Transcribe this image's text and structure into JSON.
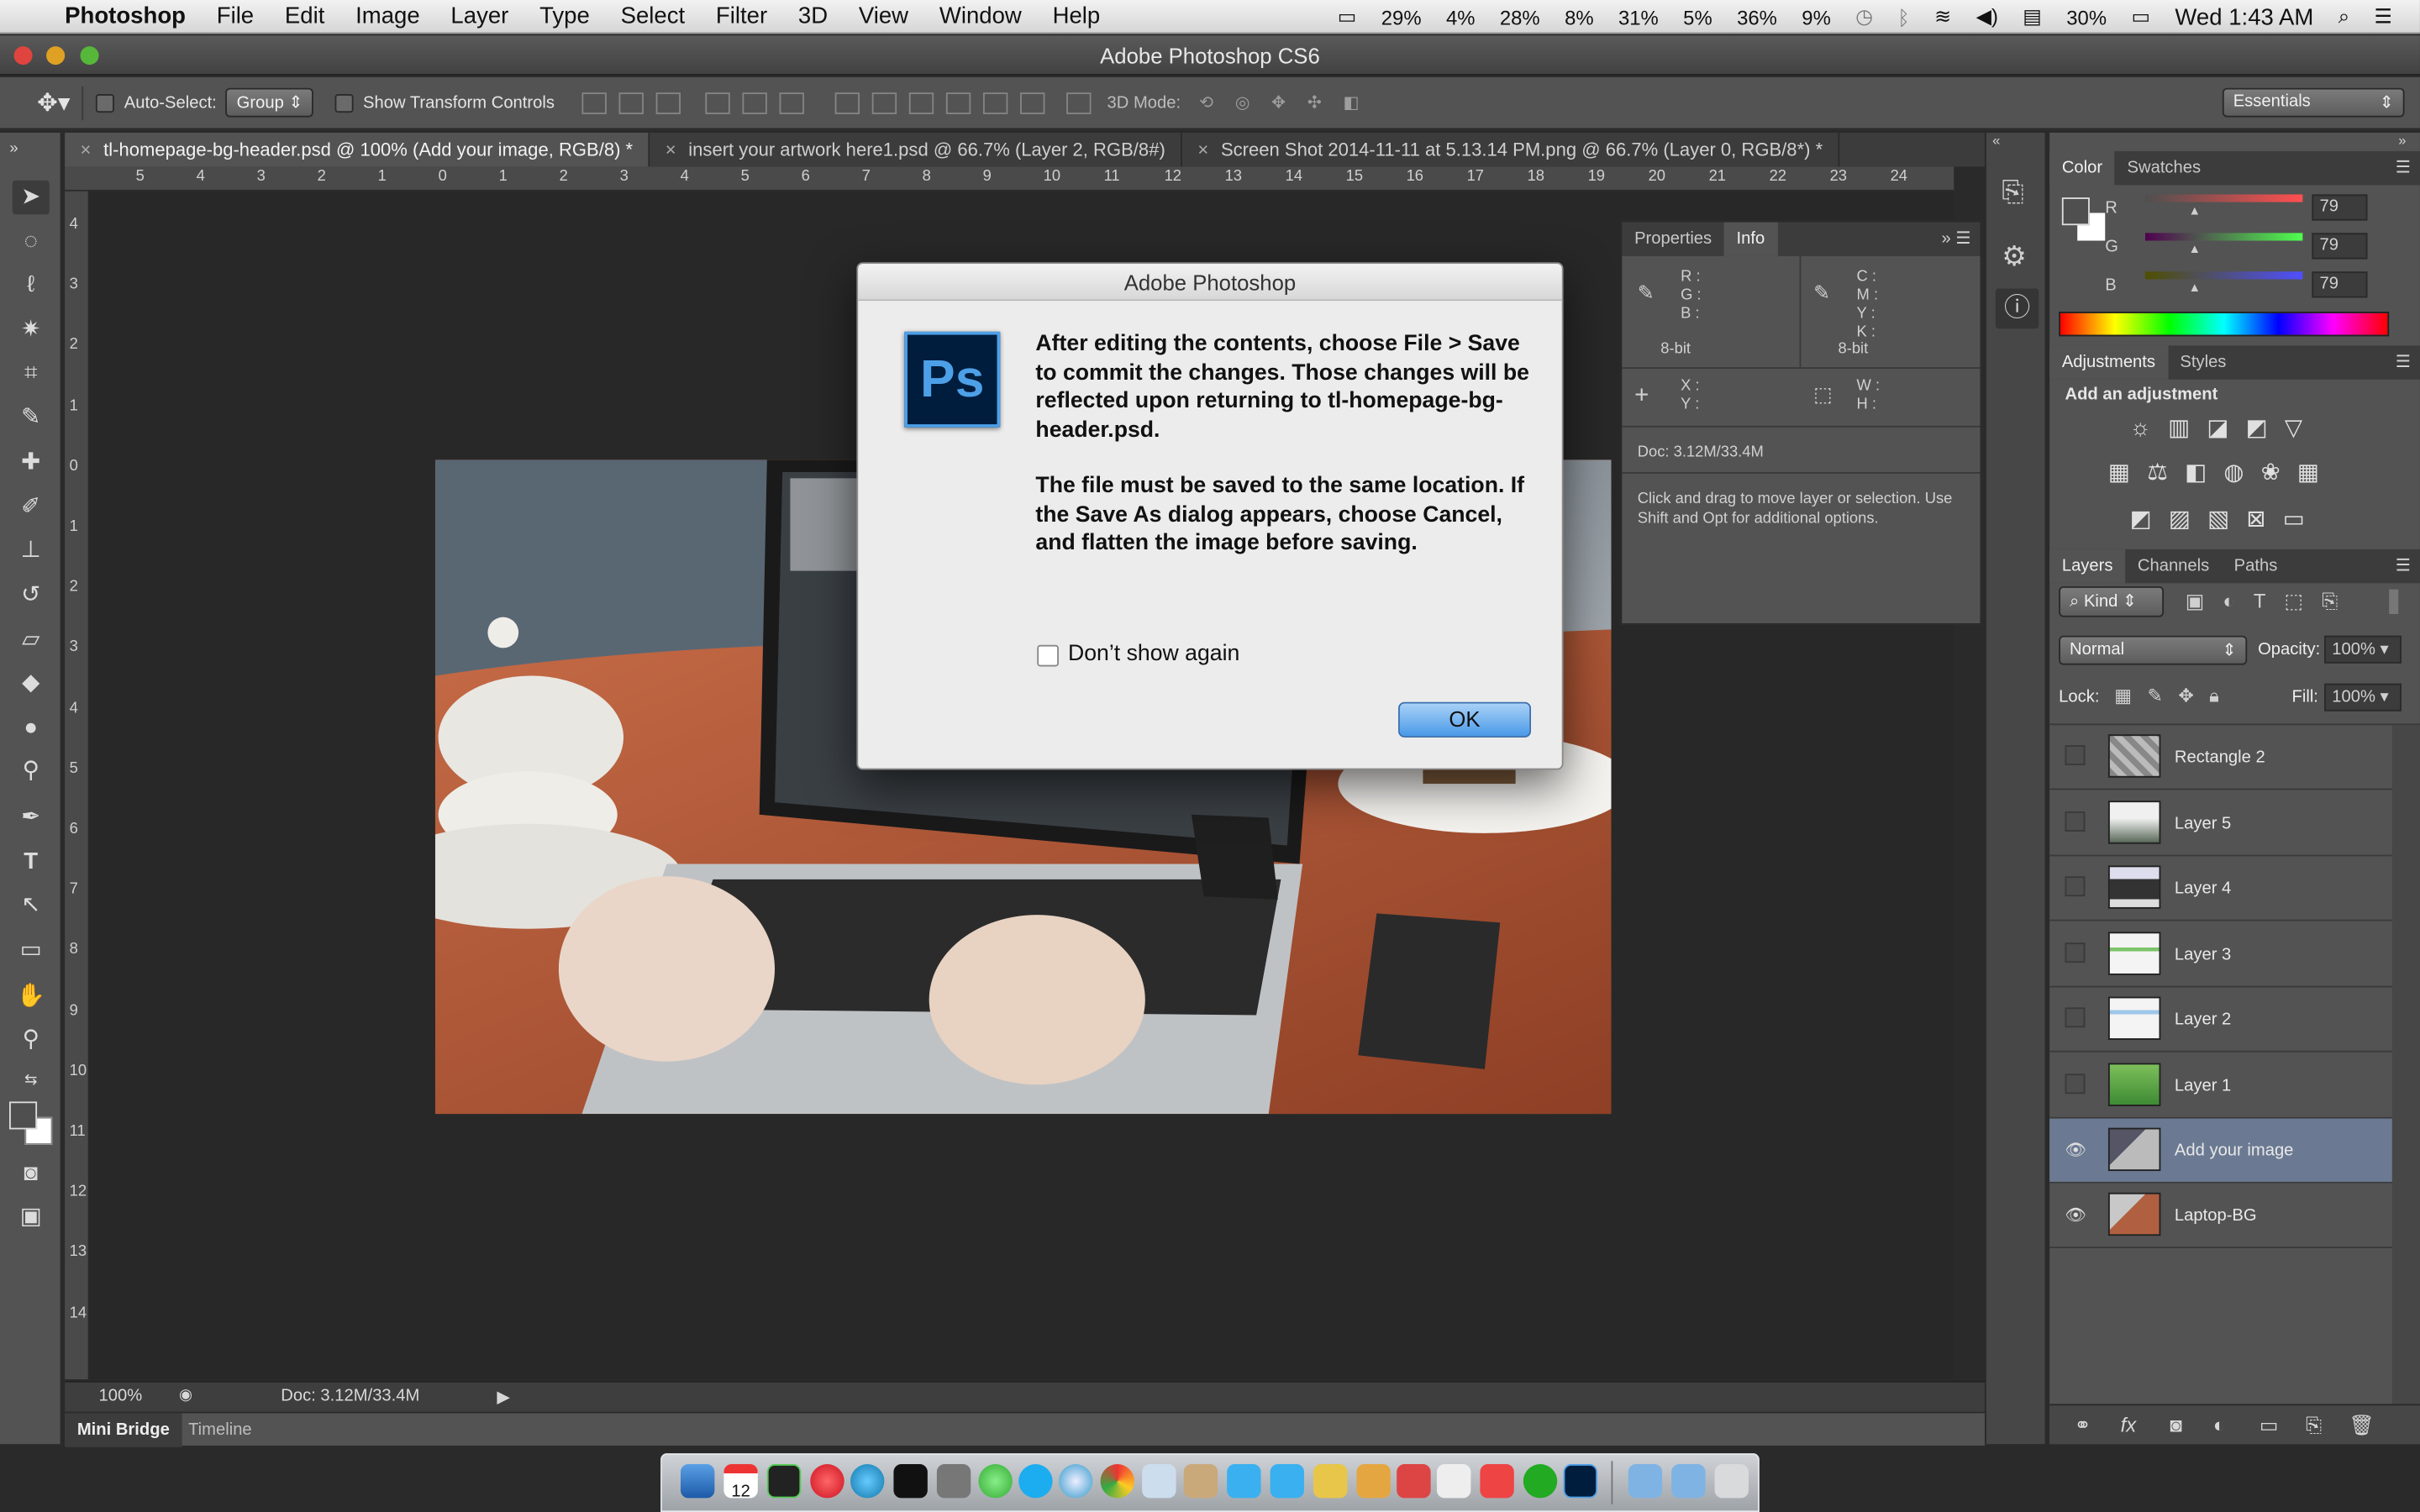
{
  "menubar": {
    "app": "Photoshop",
    "items": [
      "File",
      "Edit",
      "Image",
      "Layer",
      "Type",
      "Select",
      "Filter",
      "3D",
      "View",
      "Window",
      "Help"
    ],
    "status": [
      "29%",
      "4%",
      "28%",
      "8%",
      "31%",
      "5%",
      "36%",
      "9%"
    ],
    "battery": "30%",
    "clock": "Wed 1:43 AM"
  },
  "window": {
    "title": "Adobe Photoshop CS6"
  },
  "options": {
    "auto_select_label": "Auto-Select:",
    "auto_select_value": "Group",
    "show_transform_label": "Show Transform Controls",
    "mode_3d_label": "3D Mode:",
    "workspace": "Essentials"
  },
  "tabs": [
    {
      "label": "tl-homepage-bg-header.psd @ 100% (Add your image, RGB/8) *"
    },
    {
      "label": "insert your artwork here1.psd @ 66.7% (Layer 2, RGB/8#)"
    },
    {
      "label": "Screen Shot 2014-11-11 at 5.13.14 PM.png @ 66.7% (Layer 0, RGB/8*) *"
    }
  ],
  "hruler": [
    "5",
    "4",
    "3",
    "2",
    "1",
    "0",
    "1",
    "2",
    "3",
    "4",
    "5",
    "6",
    "7",
    "8",
    "9",
    "10",
    "11",
    "12",
    "13",
    "14",
    "15",
    "16",
    "17",
    "18",
    "19",
    "20",
    "21",
    "22",
    "23",
    "24"
  ],
  "vruler": [
    "4",
    "3",
    "2",
    "1",
    "0",
    "1",
    "2",
    "3",
    "4",
    "5",
    "6",
    "7",
    "8",
    "9",
    "10",
    "11",
    "12",
    "13",
    "14"
  ],
  "status": {
    "zoom": "100%",
    "doc": "Doc: 3.12M/33.4M"
  },
  "bottom_tabs": {
    "mini_bridge": "Mini Bridge",
    "timeline": "Timeline"
  },
  "info_panel": {
    "tab_properties": "Properties",
    "tab_info": "Info",
    "rgb_labels": [
      "R :",
      "G :",
      "B :"
    ],
    "cmyk_labels": [
      "C :",
      "M :",
      "Y :",
      "K :"
    ],
    "bit_left": "8-bit",
    "bit_right": "8-bit",
    "xy_labels": [
      "X :",
      "Y :"
    ],
    "wh_labels": [
      "W :",
      "H :"
    ],
    "doc": "Doc: 3.12M/33.4M",
    "hint": "Click and drag to move layer or selection. Use Shift and Opt for additional options."
  },
  "color_panel": {
    "tab_color": "Color",
    "tab_swatches": "Swatches",
    "r_label": "R",
    "g_label": "G",
    "b_label": "B",
    "r": "79",
    "g": "79",
    "b": "79"
  },
  "adjustments": {
    "tab": "Adjustments",
    "tab2": "Styles",
    "heading": "Add an adjustment"
  },
  "layers_panel": {
    "tab_layers": "Layers",
    "tab_channels": "Channels",
    "tab_paths": "Paths",
    "kind": "Kind",
    "blend": "Normal",
    "opacity_label": "Opacity:",
    "opacity": "100%",
    "lock_label": "Lock:",
    "fill_label": "Fill:",
    "fill": "100%",
    "layers": [
      {
        "name": "Rectangle 2",
        "visible": false,
        "selected": false
      },
      {
        "name": "Layer 5",
        "visible": false,
        "selected": false
      },
      {
        "name": "Layer 4",
        "visible": false,
        "selected": false
      },
      {
        "name": "Layer 3",
        "visible": false,
        "selected": false
      },
      {
        "name": "Layer 2",
        "visible": false,
        "selected": false
      },
      {
        "name": "Layer 1",
        "visible": false,
        "selected": false
      },
      {
        "name": "Add your image",
        "visible": true,
        "selected": true
      },
      {
        "name": "Laptop-BG",
        "visible": true,
        "selected": false
      }
    ]
  },
  "dialog": {
    "title": "Adobe Photoshop",
    "icon_text": "Ps",
    "message1": "After editing the contents, choose File > Save to commit the changes.  Those changes will be reflected upon returning to tl-homepage-bg-header.psd.",
    "message2": "The file must be saved to the same location. If the Save As dialog appears, choose Cancel, and flatten the image before saving.",
    "checkbox_label": "Don’t show again",
    "ok": "OK"
  },
  "dock": {
    "calendar_date": "12"
  }
}
